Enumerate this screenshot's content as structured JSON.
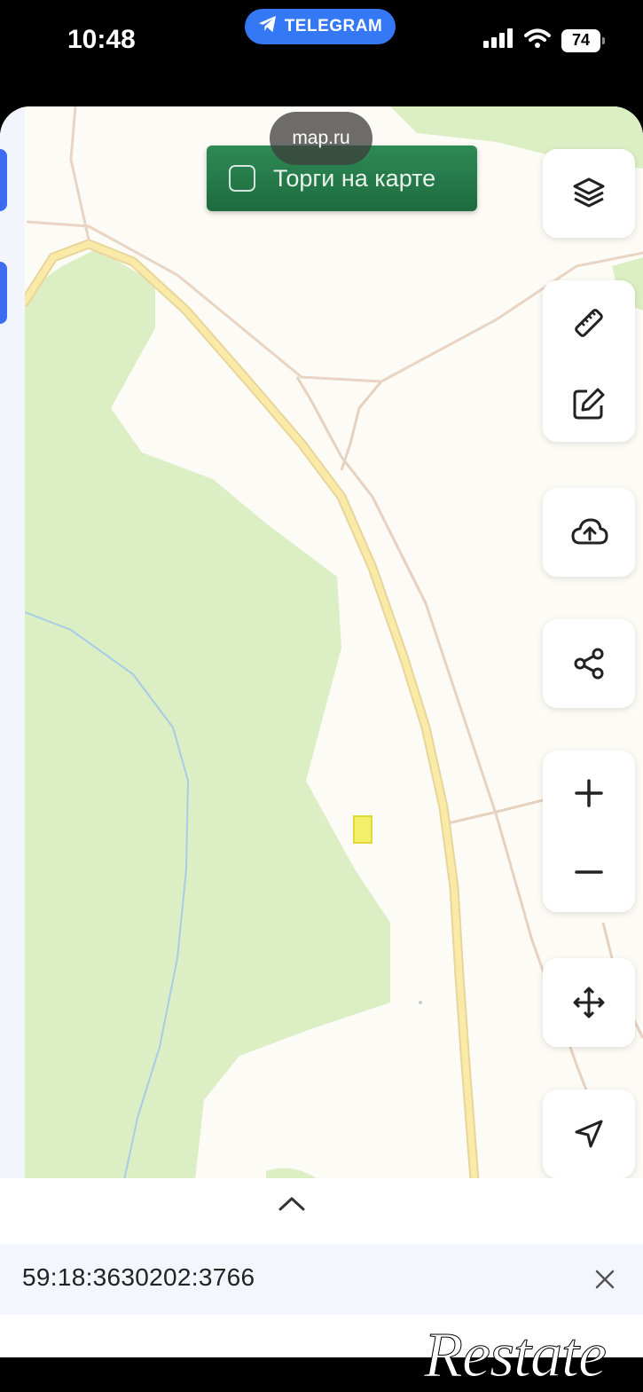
{
  "status_bar": {
    "time": "10:48",
    "telegram_label": "TELEGRAM",
    "battery": "74"
  },
  "browser": {
    "url": "map.ru"
  },
  "map": {
    "auction_toggle_label": "Торги на карте",
    "auction_checked": false,
    "tools": [
      {
        "name": "layers-icon"
      },
      {
        "name": "ruler-icon"
      },
      {
        "name": "edit-icon"
      },
      {
        "name": "cloud-upload-icon"
      },
      {
        "name": "share-icon"
      },
      {
        "name": "zoom-in-icon"
      },
      {
        "name": "zoom-out-icon"
      },
      {
        "name": "move-icon"
      },
      {
        "name": "navigation-icon"
      }
    ],
    "colors": {
      "land": "#fdfbf5",
      "forest": "#dbeec4",
      "road": "#f8e39a",
      "water": "#9fc8e8",
      "parcel": "#f3ee5a"
    }
  },
  "sheet": {
    "cadastral_number": "59:18:3630202:3766"
  },
  "watermark": "Restate"
}
